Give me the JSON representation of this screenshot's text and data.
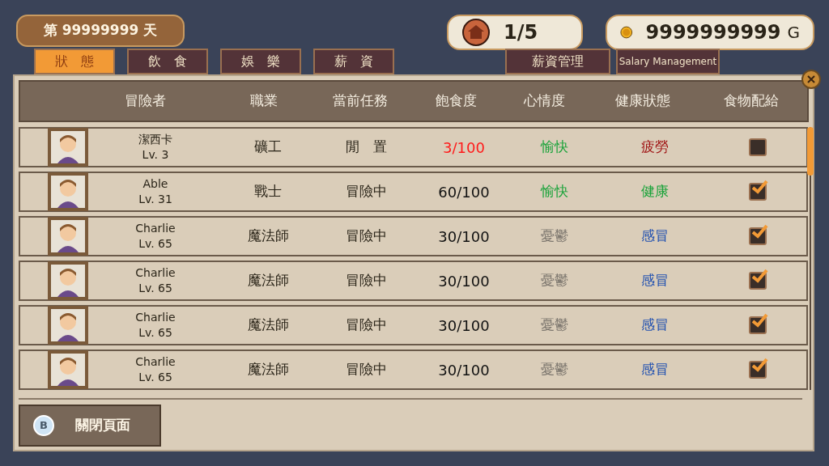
{
  "day_badge": {
    "text": "第 99999999 天"
  },
  "counters": [
    {
      "kind": "house",
      "text": "1/5"
    },
    {
      "kind": "gold",
      "text": "9999999999",
      "unit": "G"
    }
  ],
  "tabs": [
    {
      "label": "狀　態",
      "selected": true
    },
    {
      "label": "飲　食",
      "selected": false
    },
    {
      "label": "娛　樂",
      "selected": false
    },
    {
      "label": "薪　資",
      "selected": false
    },
    {
      "label": "薪資管理",
      "selected": false
    },
    {
      "label": "Salary Management",
      "selected": false
    }
  ],
  "table": {
    "columns": [
      "冒險者",
      "職業",
      "當前任務",
      "飽食度",
      "心情度",
      "健康狀態",
      "食物配給"
    ],
    "rows": [
      {
        "name": "潔西卡",
        "level": "Lv. 3",
        "job": "礦工",
        "task": "閒　置",
        "satiety": {
          "text": "3/100",
          "color": "#ff1a1a"
        },
        "mood": {
          "text": "愉快",
          "color": "#1aa33a"
        },
        "health": {
          "text": "疲勞",
          "color": "#a01414"
        },
        "checked": false
      },
      {
        "name": "Able",
        "level": "Lv. 31",
        "job": "戰士",
        "task": "冒險中",
        "satiety": {
          "text": "60/100",
          "color": "#111111"
        },
        "mood": {
          "text": "愉快",
          "color": "#1aa33a"
        },
        "health": {
          "text": "健康",
          "color": "#1aa33a"
        },
        "checked": true
      },
      {
        "name": "Charlie",
        "level": "Lv. 65",
        "job": "魔法師",
        "task": "冒險中",
        "satiety": {
          "text": "30/100",
          "color": "#111111"
        },
        "mood": {
          "text": "憂鬱",
          "color": "#7d776f"
        },
        "health": {
          "text": "感冒",
          "color": "#2050b0"
        },
        "checked": true
      },
      {
        "name": "Charlie",
        "level": "Lv. 65",
        "job": "魔法師",
        "task": "冒險中",
        "satiety": {
          "text": "30/100",
          "color": "#111111"
        },
        "mood": {
          "text": "憂鬱",
          "color": "#7d776f"
        },
        "health": {
          "text": "感冒",
          "color": "#2050b0"
        },
        "checked": true
      },
      {
        "name": "Charlie",
        "level": "Lv. 65",
        "job": "魔法師",
        "task": "冒險中",
        "satiety": {
          "text": "30/100",
          "color": "#111111"
        },
        "mood": {
          "text": "憂鬱",
          "color": "#7d776f"
        },
        "health": {
          "text": "感冒",
          "color": "#2050b0"
        },
        "checked": true
      },
      {
        "name": "Charlie",
        "level": "Lv. 65",
        "job": "魔法師",
        "task": "冒險中",
        "satiety": {
          "text": "30/100",
          "color": "#111111"
        },
        "mood": {
          "text": "憂鬱",
          "color": "#7d776f"
        },
        "health": {
          "text": "感冒",
          "color": "#2050b0"
        },
        "checked": true
      }
    ]
  },
  "close_page_button": {
    "key": "B",
    "label": "關閉頁面"
  }
}
